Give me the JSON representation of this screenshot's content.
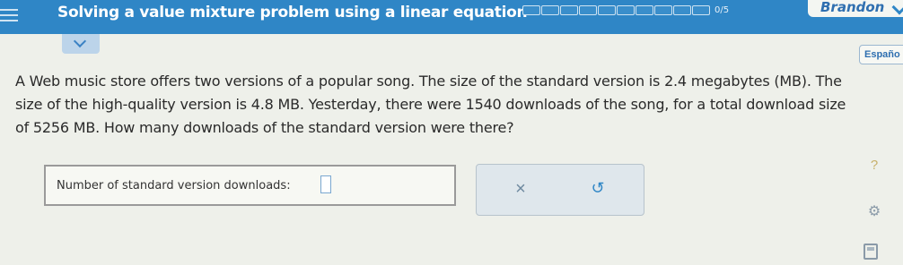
{
  "header": {
    "title": "Solving a value mixture problem using a linear equation",
    "progress_text": "0/5",
    "user_name": "Brandon"
  },
  "language_button": "Españo",
  "question": {
    "text": "A Web music store offers two versions of a popular song. The size of the standard version is 2.4 megabytes (MB). The size of the high-quality version is 4.8 MB. Yesterday, there were 1540 downloads of the song, for a total download size of 5256 MB. How many downloads of the standard version were there?"
  },
  "answer": {
    "label": "Number of standard version downloads:",
    "value": ""
  },
  "buttons": {
    "clear_icon": "×",
    "undo_icon": "↺"
  },
  "side_tools": {
    "help_icon": "?",
    "tools_icon": "⚙"
  }
}
